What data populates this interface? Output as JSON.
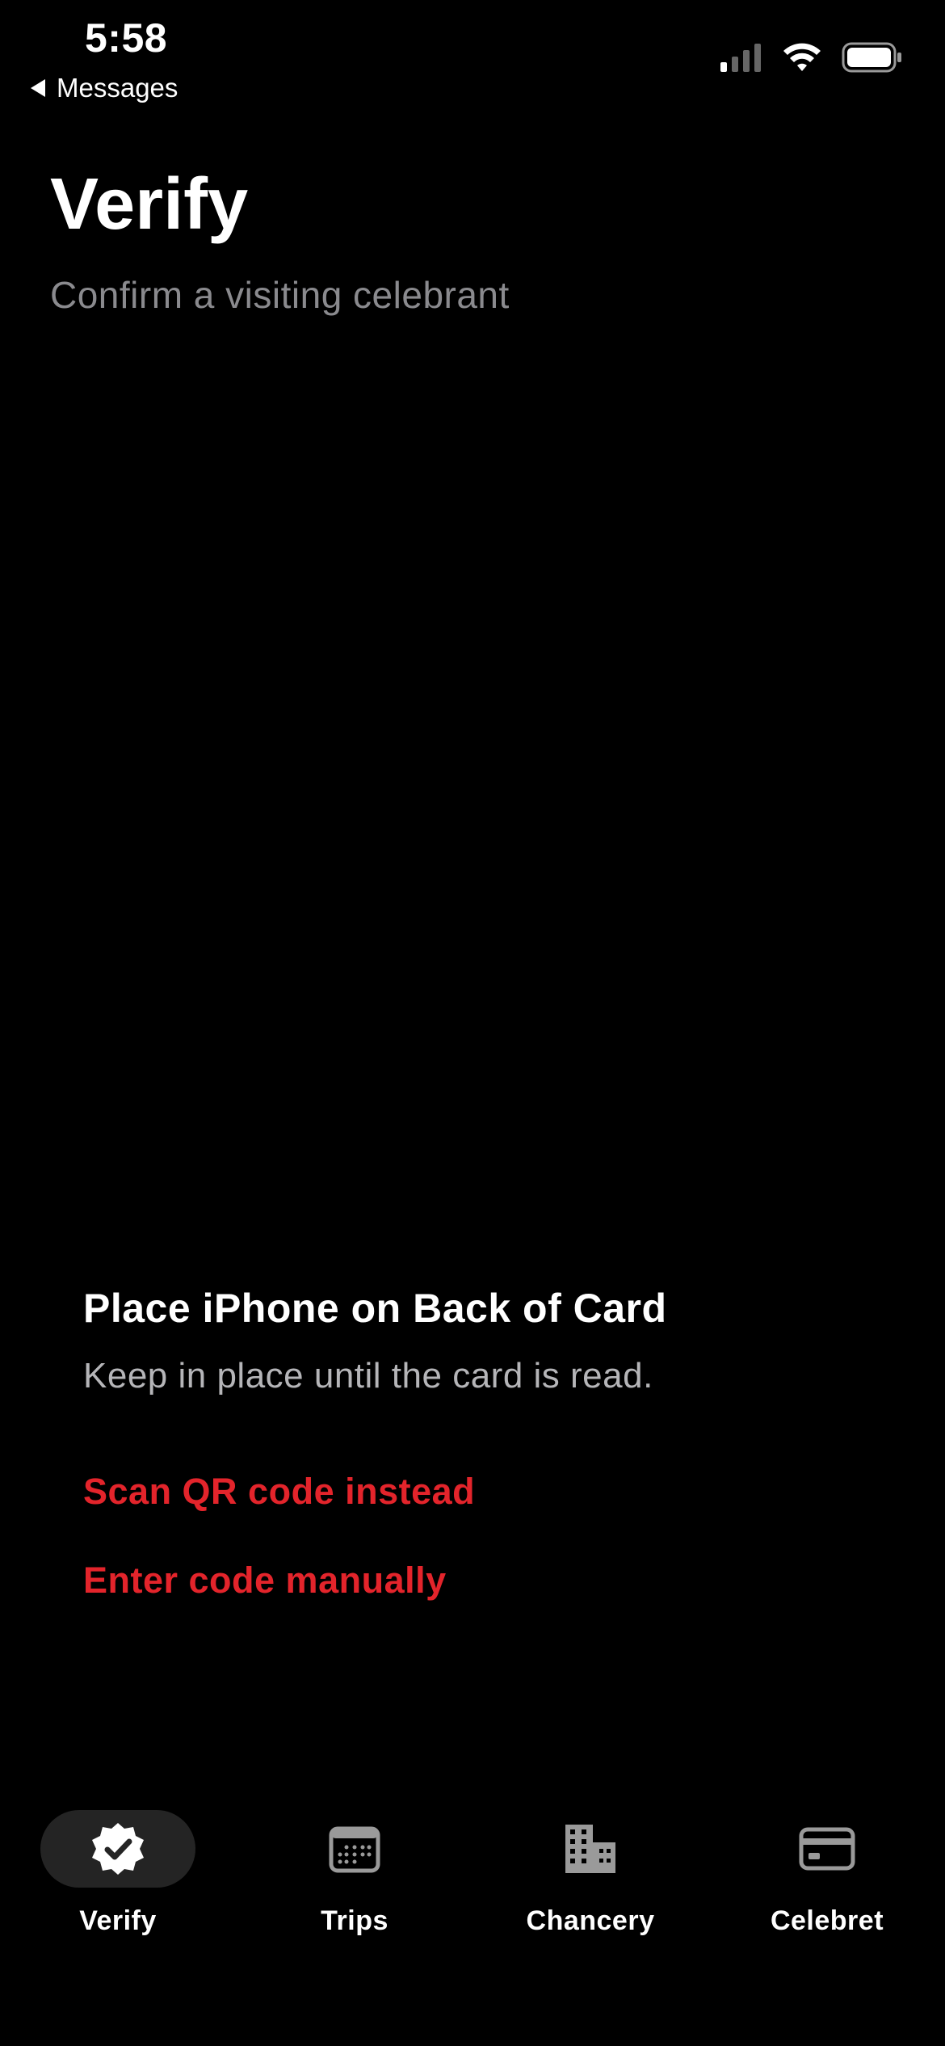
{
  "status_bar": {
    "time": "5:58",
    "back_label": "Messages"
  },
  "header": {
    "title": "Verify",
    "subtitle": "Confirm a visiting celebrant"
  },
  "prompt": {
    "title": "Place iPhone on Back of Card",
    "body": "Keep in place until the card is read.",
    "scan_qr_label": "Scan QR code instead",
    "enter_code_label": "Enter code manually"
  },
  "tabbar": {
    "active": "Verify",
    "tabs": [
      {
        "label": "Verify",
        "icon": "verified-badge-icon"
      },
      {
        "label": "Trips",
        "icon": "calendar-icon"
      },
      {
        "label": "Chancery",
        "icon": "building-icon"
      },
      {
        "label": "Celebret",
        "icon": "card-icon"
      }
    ]
  },
  "colors": {
    "background": "#000000",
    "accent": "#e3242b",
    "secondary_text": "#8a8a8e",
    "active_tab_bg": "#242424"
  }
}
